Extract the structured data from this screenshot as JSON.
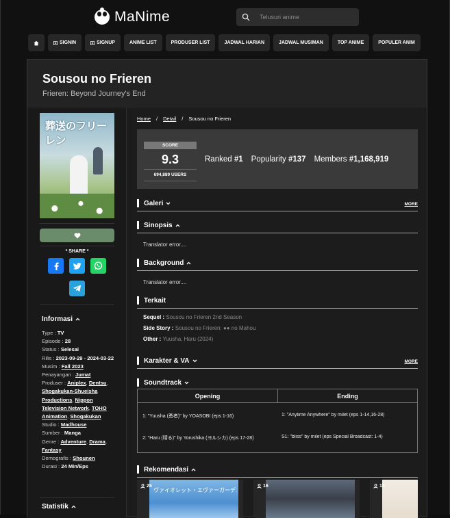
{
  "brand": {
    "name": "MaNime"
  },
  "search": {
    "placeholder": "Telusuri anime"
  },
  "nav": {
    "signin": "SIGNIN",
    "signup": "SIGNUP",
    "anime_list": "ANIME LIST",
    "produser_list": "PRODUSER LIST",
    "jadwal_harian": "JADWAL HARIAN",
    "jadwal_musiman": "JADWAL MUSIMAN",
    "top_anime": "TOP ANIME",
    "populer_anime": "POPULER ANIM"
  },
  "anime": {
    "title": "Sousou no Frieren",
    "subtitle": "Frieren: Beyond Journey's End",
    "poster_text": "葬送のフリーレン"
  },
  "share": {
    "label": "* SHARE *"
  },
  "info": {
    "heading": "Informasi",
    "type_label": "Type : ",
    "type": "TV",
    "episode_label": "Episode : ",
    "episode": "28",
    "status_label": "Status : ",
    "status": "Selesai",
    "rilis_label": "Rilis : ",
    "rilis": "2023-09-29 - 2024-03-22",
    "musim_label": "Musim : ",
    "musim": "Fall 2023",
    "penayangan_label": "Penayangan : ",
    "penayangan": "Jumat",
    "produser_label": "Produser : ",
    "produser": [
      "Aniplex",
      "Dentsu",
      "Shogakukan-Shueisha Productions",
      "Nippon Television Network",
      "TOHO Animation",
      "Shogakukan"
    ],
    "studio_label": "Studio : ",
    "studio": "Madhouse",
    "sumber_label": "Sumber : ",
    "sumber": "Manga",
    "genre_label": "Genre : ",
    "genre": [
      "Adventure",
      "Drama",
      "Fantasy"
    ],
    "demografis_label": "Demografis : ",
    "demografis": "Shounen",
    "durasi_label": "Durasi : ",
    "durasi": "24 Min/Eps"
  },
  "statistik": {
    "heading": "Statistik"
  },
  "breadcrumb": {
    "home": "Home",
    "detail": "Detail",
    "current": "Sousou no Frieren",
    "sep": "/"
  },
  "score": {
    "label": "SCORE",
    "value": "9.3",
    "users": "694,889 USERS",
    "ranked_label": "Ranked ",
    "ranked": "#1",
    "popularity_label": "Popularity ",
    "popularity": "#137",
    "members_label": "Members ",
    "members": "#1,168,919"
  },
  "sections": {
    "galeri": "Galeri",
    "sinopsis": "Sinopsis",
    "sinopsis_text": "Translator error....",
    "background": "Background",
    "background_text": "Translator error....",
    "terkait": "Terkait",
    "karakter": "Karakter & VA",
    "soundtrack": "Soundtrack",
    "rekomendasi": "Rekomendasi",
    "more": "MORE"
  },
  "terkait": {
    "sequel_label": "Sequel : ",
    "sequel": "Sousou no Frieren 2nd Season",
    "side_label": "Side Story : ",
    "side": "Sousou no Frieren: ●● no Mahou",
    "other_label": "Other : ",
    "other": "Yuusha, Haru (2024)"
  },
  "soundtrack": {
    "opening_head": "Opening",
    "ending_head": "Ending",
    "opening": [
      "1: \"Yuusha (勇者)\" by YOASOBI (eps 1-16)",
      "2: \"Haru (晴る)\" by Yorushika (ヨルシカ) (eps 17-28)"
    ],
    "ending": [
      "1: \"Anytime Anywhere\" by milet (eps 1-14,16-28)",
      "S1: \"bliss\" by milet (eps Special Broadcast: 1-4)"
    ]
  },
  "recs": [
    {
      "count": "26",
      "jp": "ヴァイオレット・エヴァーガーデン"
    },
    {
      "count": "16"
    },
    {
      "count": "15"
    }
  ],
  "colors": {
    "accent": "#6b8c6b",
    "facebook": "#1877f2",
    "twitter": "#1da1f2",
    "whatsapp": "#25d366",
    "telegram": "#2aa1da"
  }
}
